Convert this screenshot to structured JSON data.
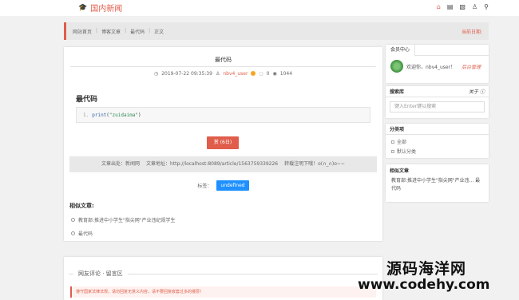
{
  "header": {
    "site_name": "国内新闻",
    "icons": [
      "home-icon",
      "news-icon",
      "doc-icon",
      "user-icon",
      "search-icon"
    ]
  },
  "breadcrumb": {
    "items": [
      "网站首页",
      "博客文章",
      "最代码",
      "正文"
    ],
    "current_date_label": "当前日期:"
  },
  "article": {
    "title": "最代码",
    "datetime": "2019-07-22 09:35:39",
    "author": "nbv4_user",
    "comments": "0",
    "views": "1044",
    "heading": "最代码",
    "code": {
      "line_no": "1.",
      "fn": "print",
      "open": "(",
      "arg": "\"zuidaima\"",
      "close": ")"
    },
    "reward_label": "赏 (6日)",
    "source_label": "文章出处：新闻网",
    "url_label": "文章地址：http://localhost:8089/article/1563759339226",
    "reprint_label": "转载注明下哦！o(∩_∩)o~~",
    "tags_label": "标签：",
    "tag": "undefined",
    "similar_heading": "相似文章:",
    "similar": [
      "教育部:推进中小学生\"指尖网\"产业违纪规学生",
      "最代码"
    ]
  },
  "sidebar": {
    "member_tab": "会员中心",
    "welcome": "欢迎你，nbv4_user！",
    "admin_link": "后台管理",
    "search_title": "搜索库",
    "about_link": "关于",
    "search_placeholder": "键入Enter键以搜索",
    "category_title": "分类项",
    "categories": [
      "全部",
      "默认分类"
    ],
    "related_title": "相似文章",
    "related_text": "教育部:推进中小学生\"指尖网\"产业违... 最代码"
  },
  "comments": {
    "title": "网友评论 · 留言区",
    "notice": "遵守国家法律法规，请勿回复无意义内容，请不要回复嵌套过多的楼层！"
  },
  "watermark": {
    "line1": "源码海洋网",
    "line2": "www.codehy.com"
  },
  "colors": {
    "accent": "#e05d4b",
    "tag_blue": "#1e90ff"
  }
}
